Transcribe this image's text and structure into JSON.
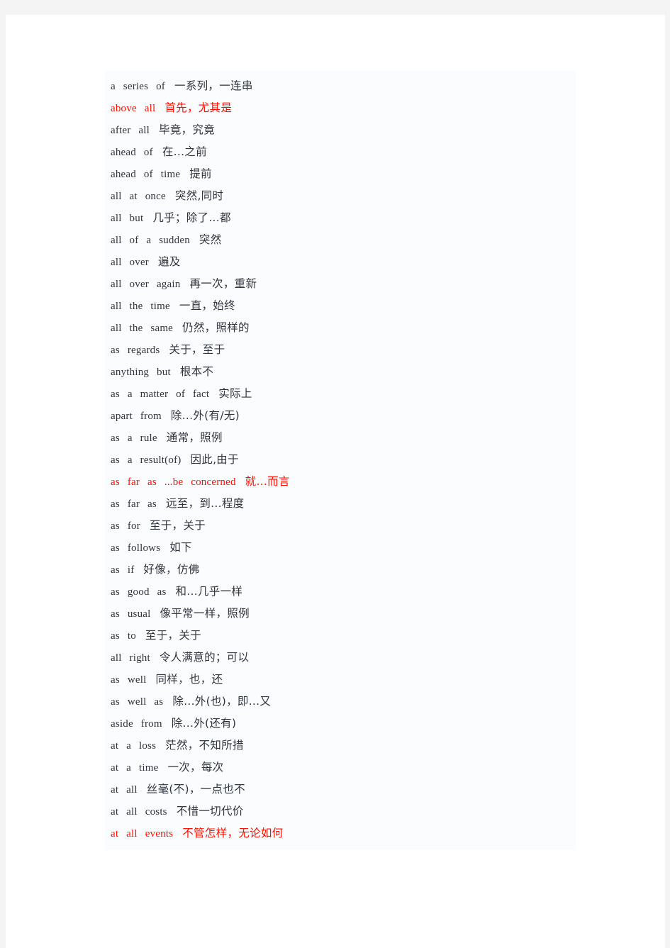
{
  "document": {
    "title": "English Phrase List with Chinese Glosses",
    "page_background_color": "#f4f4f4",
    "sheet_color": "#ffffff",
    "content_block_color": "#fbfcfe",
    "default_text_color": "#30343c",
    "highlight_text_color": "#fa0f00"
  },
  "entries": [
    {
      "en": "a   series   of",
      "cn": "一系列，一连串",
      "highlight": false
    },
    {
      "en": "above   all",
      "cn": "首先，尤其是",
      "highlight": true
    },
    {
      "en": "after   all",
      "cn": "毕竟，究竟",
      "highlight": false
    },
    {
      "en": "ahead   of",
      "cn": "在...之前",
      "highlight": false
    },
    {
      "en": "ahead   of   time",
      "cn": "提前",
      "highlight": false
    },
    {
      "en": "all   at   once",
      "cn": "突然,同时",
      "highlight": false
    },
    {
      "en": "all   but",
      "cn": "几乎；除了...都",
      "highlight": false
    },
    {
      "en": "all   of   a   sudden",
      "cn": "突然",
      "highlight": false
    },
    {
      "en": "all   over",
      "cn": "遍及",
      "highlight": false
    },
    {
      "en": "all   over   again",
      "cn": "再一次，重新",
      "highlight": false
    },
    {
      "en": "all   the   time",
      "cn": "一直，始终",
      "highlight": false
    },
    {
      "en": "all   the   same",
      "cn": "仍然，照样的",
      "highlight": false
    },
    {
      "en": "as   regards",
      "cn": "关于，至于",
      "highlight": false
    },
    {
      "en": "anything   but",
      "cn": "根本不",
      "highlight": false
    },
    {
      "en": "as   a   matter   of   fact",
      "cn": "实际上",
      "highlight": false
    },
    {
      "en": "apart   from",
      "cn": "除...外(有/无)",
      "highlight": false
    },
    {
      "en": "as   a   rule",
      "cn": "通常，照例",
      "highlight": false
    },
    {
      "en": "as   a   result(of)",
      "cn": "因此,由于",
      "highlight": false
    },
    {
      "en": "as   far   as   ...be   concerned",
      "cn": "就...而言",
      "highlight": true
    },
    {
      "en": "as   far   as",
      "cn": "远至，到...程度",
      "highlight": false
    },
    {
      "en": "as   for",
      "cn": "至于，关于",
      "highlight": false
    },
    {
      "en": "as   follows",
      "cn": "如下",
      "highlight": false
    },
    {
      "en": "as   if",
      "cn": "好像，仿佛",
      "highlight": false
    },
    {
      "en": "as   good   as",
      "cn": "和...几乎一样",
      "highlight": false
    },
    {
      "en": "as   usual",
      "cn": "像平常一样，照例",
      "highlight": false
    },
    {
      "en": "as   to",
      "cn": "至于，关于",
      "highlight": false
    },
    {
      "en": "all   right",
      "cn": "令人满意的；可以",
      "highlight": false
    },
    {
      "en": "as   well",
      "cn": "同样，也，还",
      "highlight": false
    },
    {
      "en": "as   well   as",
      "cn": "除...外(也)，即...又",
      "highlight": false
    },
    {
      "en": "aside   from",
      "cn": "除...外(还有)",
      "highlight": false
    },
    {
      "en": "at   a   loss",
      "cn": "茫然，不知所措",
      "highlight": false
    },
    {
      "en": "at   a   time",
      "cn": "一次，每次",
      "highlight": false
    },
    {
      "en": "at   all",
      "cn": "丝毫(不)，一点也不",
      "highlight": false
    },
    {
      "en": "at   all   costs",
      "cn": "不惜一切代价",
      "highlight": false
    },
    {
      "en": "at   all   events",
      "cn": "不管怎样，无论如何",
      "highlight": true
    }
  ]
}
